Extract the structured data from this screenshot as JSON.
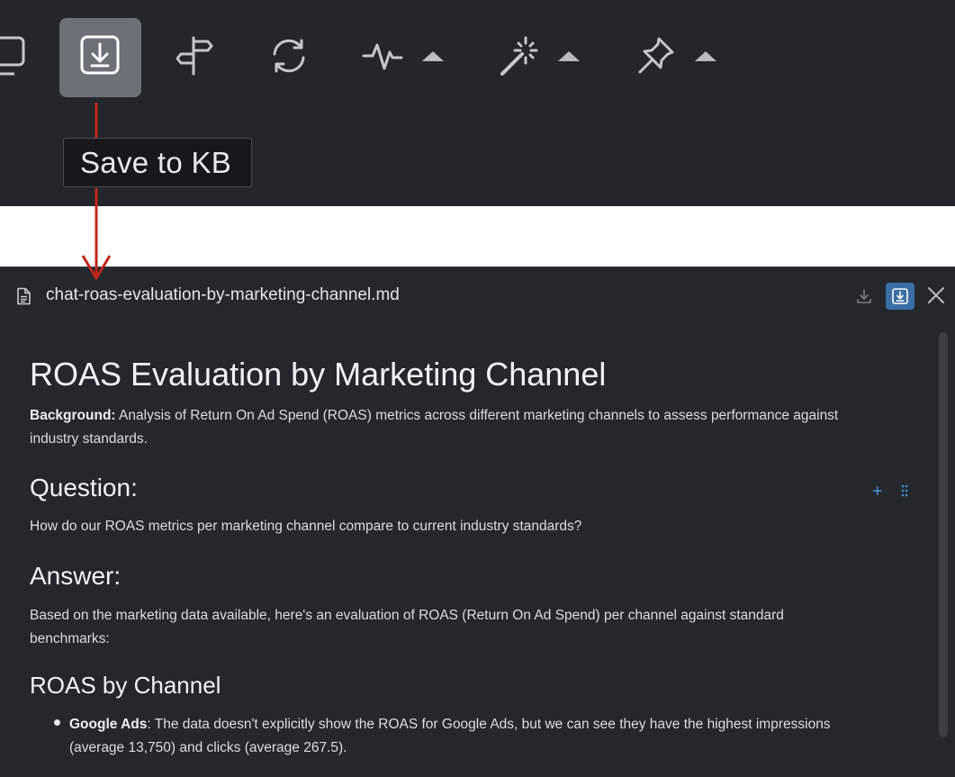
{
  "toolbar": {
    "icons": [
      "desktop-icon",
      "save-to-kb-icon",
      "signpost-icon",
      "refresh-icon",
      "pulse-icon",
      "magic-wand-icon",
      "pin-icon"
    ],
    "tooltip": "Save to KB"
  },
  "panel": {
    "file_name": "chat-roas-evaluation-by-marketing-channel.md",
    "title": "ROAS Evaluation by Marketing Channel",
    "background_label": "Background:",
    "background_text": " Analysis of Return On Ad Spend (ROAS) metrics across different marketing channels to assess performance against industry standards.",
    "question_heading": "Question:",
    "question_text": "How do our ROAS metrics per marketing channel compare to current industry standards?",
    "answer_heading": "Answer:",
    "answer_text": "Based on the marketing data available, here's an evaluation of ROAS (Return On Ad Spend) per channel against standard benchmarks:",
    "roas_heading": "ROAS by Channel",
    "list": [
      {
        "label": "Google Ads",
        "text": ": The data doesn't explicitly show the ROAS for Google Ads, but we can see they have the highest impressions (average 13,750) and clicks (average 267.5)."
      }
    ]
  },
  "colors": {
    "toolbar_bg": "#23262b",
    "panel_bg": "#24272c",
    "accent": "#3b6ea5",
    "annotation": "#c0261c"
  }
}
